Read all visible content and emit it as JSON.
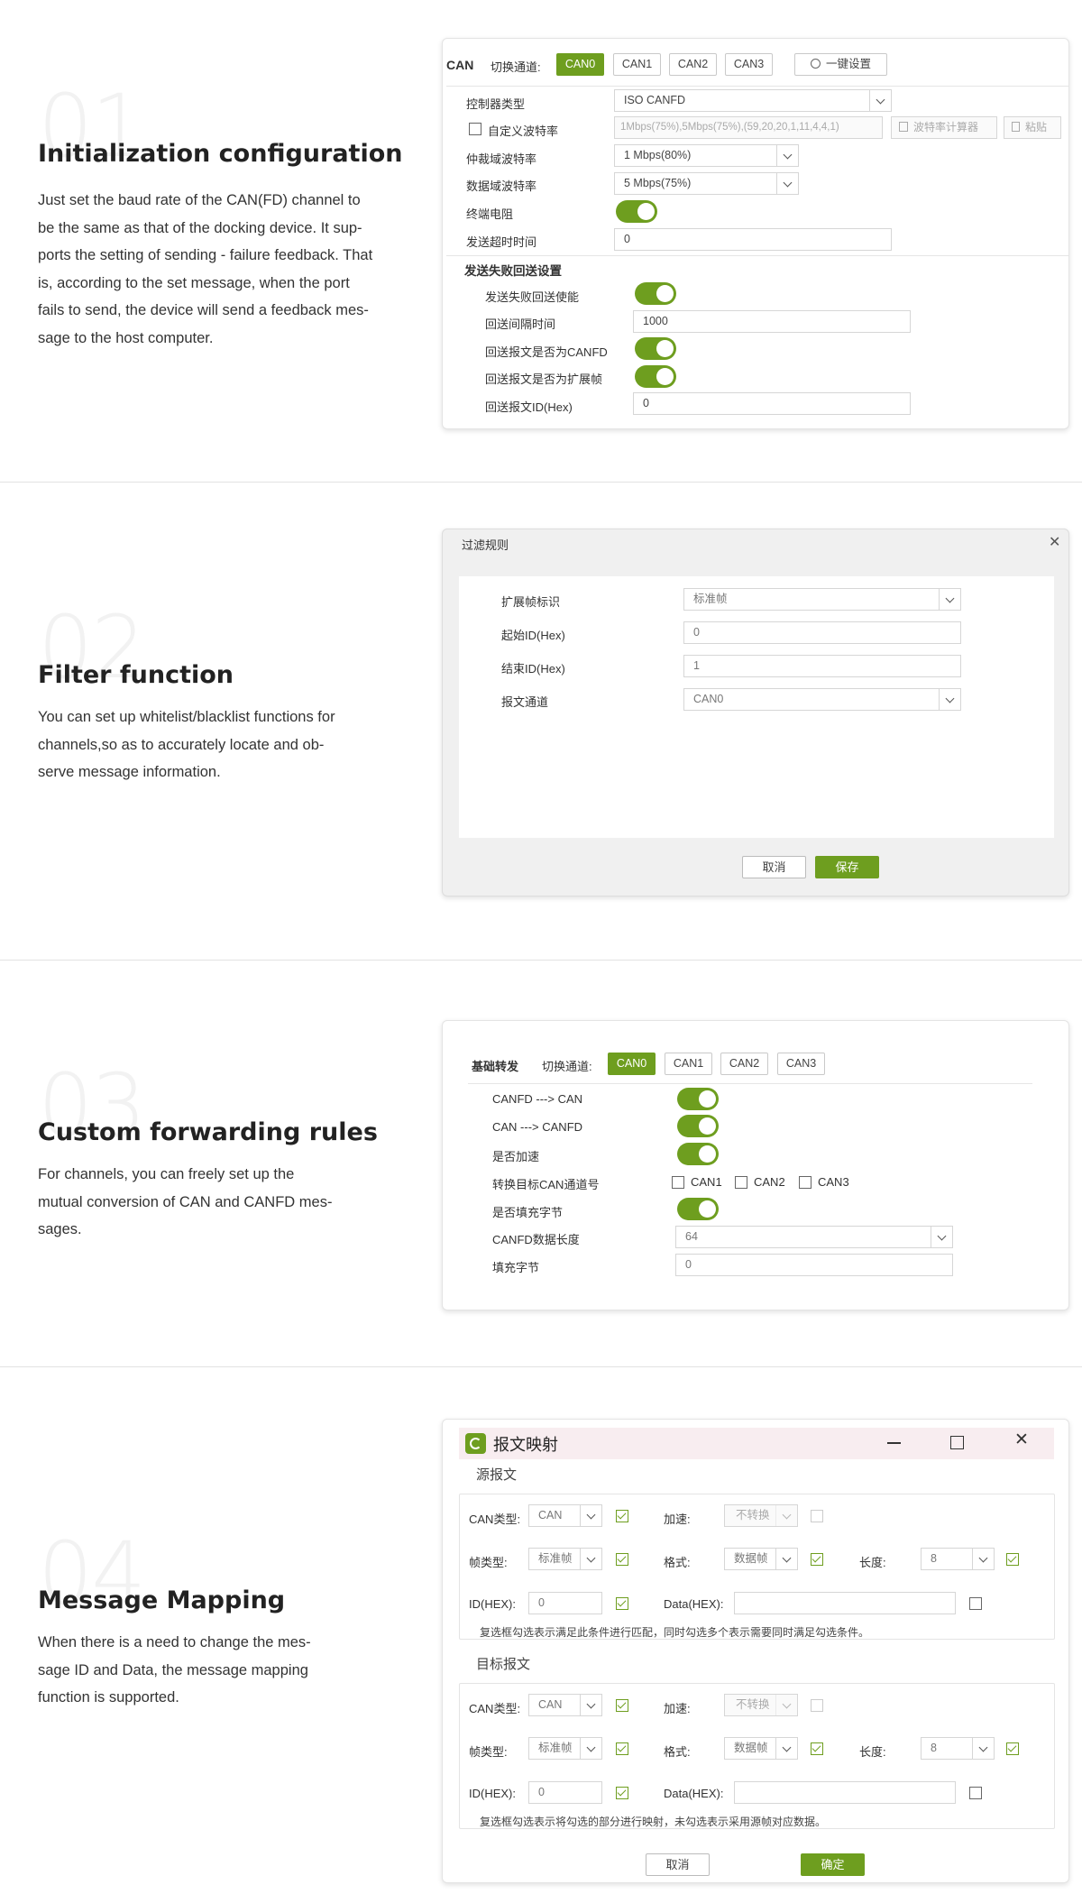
{
  "sections": [
    {
      "number": "01",
      "title": "Initialization configuration",
      "desc_lines": [
        "Just set the baud rate of the CAN(FD) channel to",
        "be the same as that of the docking device. It sup-",
        "ports the setting of sending - failure feedback. That",
        "is, according to the set message, when the port",
        "fails to send, the device will send a feedback mes-",
        "sage to the host computer."
      ]
    },
    {
      "number": "02",
      "title": "Filter function",
      "desc_lines": [
        "You can set up whitelist/blacklist functions for",
        "channels,so as to accurately locate and ob-",
        "serve message information."
      ]
    },
    {
      "number": "03",
      "title": "Custom forwarding rules",
      "desc_lines": [
        "For channels, you can freely set up the",
        "mutual conversion of CAN and CANFD mes-",
        "sages."
      ]
    },
    {
      "number": "04",
      "title": "Message Mapping",
      "desc_lines": [
        "When there is a need to change the mes-",
        "sage ID and Data, the message mapping",
        "function is supported."
      ]
    }
  ],
  "panel1": {
    "can_label": "CAN",
    "switch_label": "切换通道:",
    "channels": [
      "CAN0",
      "CAN1",
      "CAN2",
      "CAN3"
    ],
    "selected_channel": "CAN0",
    "one_click": "一键设置",
    "controller_type_label": "控制器类型",
    "controller_type_value": "ISO CANFD",
    "custom_baud_label": "自定义波特率",
    "custom_baud_value": "1Mbps(75%),5Mbps(75%),(59,20,20,1,11,4,4,1)",
    "baud_calc": "波特率计算器",
    "paste": "粘贴",
    "arb_label": "仲裁域波特率",
    "arb_value": "1 Mbps(80%)",
    "data_label": "数据域波特率",
    "data_value": "5 Mbps(75%)",
    "term_label": "终端电阻",
    "term_on": true,
    "timeout_label": "发送超时时间",
    "timeout_value": "0",
    "fail_section": "发送失败回送设置",
    "fail_enable_label": "发送失败回送使能",
    "fail_enable_on": true,
    "interval_label": "回送间隔时间",
    "interval_value": "1000",
    "is_canfd_label": "回送报文是否为CANFD",
    "is_canfd_on": true,
    "is_ext_label": "回送报文是否为扩展帧",
    "is_ext_on": true,
    "id_label": "回送报文ID(Hex)",
    "id_value": "0"
  },
  "panel2": {
    "title": "过滤规则",
    "ext_label": "扩展帧标识",
    "ext_value": "标准帧",
    "start_label": "起始ID(Hex)",
    "start_value": "0",
    "end_label": "结束ID(Hex)",
    "end_value": "1",
    "channel_label": "报文通道",
    "channel_value": "CAN0",
    "cancel": "取消",
    "save": "保存"
  },
  "panel3": {
    "title": "基础转发",
    "switch_label": "切换通道:",
    "channels": [
      "CAN0",
      "CAN1",
      "CAN2",
      "CAN3"
    ],
    "selected_channel": "CAN0",
    "r1_label": "CANFD ---> CAN",
    "r1_on": true,
    "r2_label": "CAN ---> CANFD",
    "r2_on": true,
    "r3_label": "是否加速",
    "r3_on": true,
    "r4_label": "转换目标CAN通道号",
    "targets": [
      "CAN1",
      "CAN2",
      "CAN3"
    ],
    "r5_label": "是否填充字节",
    "r5_on": true,
    "r6_label": "CANFD数据长度",
    "r6_value": "64",
    "r7_label": "填充字节",
    "r7_value": "0"
  },
  "panel4": {
    "title": "报文映射",
    "src_label": "源报文",
    "dst_label": "目标报文",
    "can_type_label": "CAN类型:",
    "can_type_value": "CAN",
    "accel_label": "加速:",
    "accel_value": "不转换",
    "frame_type_label": "帧类型:",
    "frame_type_value": "标准帧",
    "format_label": "格式:",
    "format_value": "数据帧",
    "length_label": "长度:",
    "length_value": "8",
    "id_label": "ID(HEX):",
    "id_value": "0",
    "data_label": "Data(HEX):",
    "data_value": "",
    "src_note": "复选框勾选表示满足此条件进行匹配，同时勾选多个表示需要同时满足勾选条件。",
    "dst_note": "复选框勾选表示将勾选的部分进行映射，未勾选表示采用源帧对应数据。",
    "cancel": "取消",
    "ok": "确定"
  },
  "colors": {
    "accent": "#6e9e1f"
  }
}
